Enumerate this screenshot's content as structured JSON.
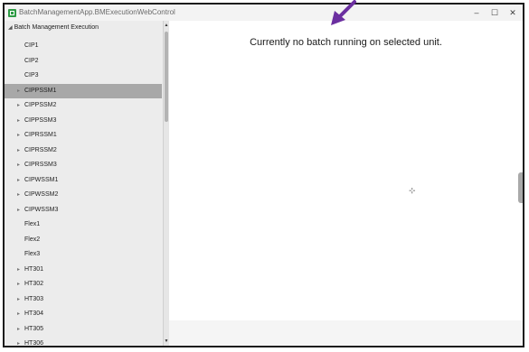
{
  "window": {
    "title": "BatchManagementApp.BMExecutionWebControl",
    "minimize": "–",
    "maximize": "☐",
    "close": "✕"
  },
  "sidebar": {
    "root_label": "Batch Management Execution",
    "items": [
      {
        "label": "CIP1",
        "expandable": false,
        "selected": false
      },
      {
        "label": "CIP2",
        "expandable": false,
        "selected": false
      },
      {
        "label": "CIP3",
        "expandable": false,
        "selected": false
      },
      {
        "label": "CIPPSSM1",
        "expandable": true,
        "selected": true
      },
      {
        "label": "CIPPSSM2",
        "expandable": true,
        "selected": false
      },
      {
        "label": "CIPPSSM3",
        "expandable": true,
        "selected": false
      },
      {
        "label": "CIPRSSM1",
        "expandable": true,
        "selected": false
      },
      {
        "label": "CIPRSSM2",
        "expandable": true,
        "selected": false
      },
      {
        "label": "CIPRSSM3",
        "expandable": true,
        "selected": false
      },
      {
        "label": "CIPWSSM1",
        "expandable": true,
        "selected": false
      },
      {
        "label": "CIPWSSM2",
        "expandable": true,
        "selected": false
      },
      {
        "label": "CIPWSSM3",
        "expandable": true,
        "selected": false
      },
      {
        "label": "Flex1",
        "expandable": false,
        "selected": false
      },
      {
        "label": "Flex2",
        "expandable": false,
        "selected": false
      },
      {
        "label": "Flex3",
        "expandable": false,
        "selected": false
      },
      {
        "label": "HT301",
        "expandable": true,
        "selected": false
      },
      {
        "label": "HT302",
        "expandable": true,
        "selected": false
      },
      {
        "label": "HT303",
        "expandable": true,
        "selected": false
      },
      {
        "label": "HT304",
        "expandable": true,
        "selected": false
      },
      {
        "label": "HT305",
        "expandable": true,
        "selected": false
      },
      {
        "label": "HT306",
        "expandable": true,
        "selected": false
      }
    ]
  },
  "main": {
    "message": "Currently no batch running on selected unit."
  },
  "colors": {
    "selected_row": "#a8a8a8",
    "annotation_arrow": "#6b2fa0",
    "app_icon": "#2e9b45"
  },
  "icons": {
    "app": "app-icon",
    "cursor": "crosshair-cursor-icon",
    "annotation": "arrow-icon"
  }
}
